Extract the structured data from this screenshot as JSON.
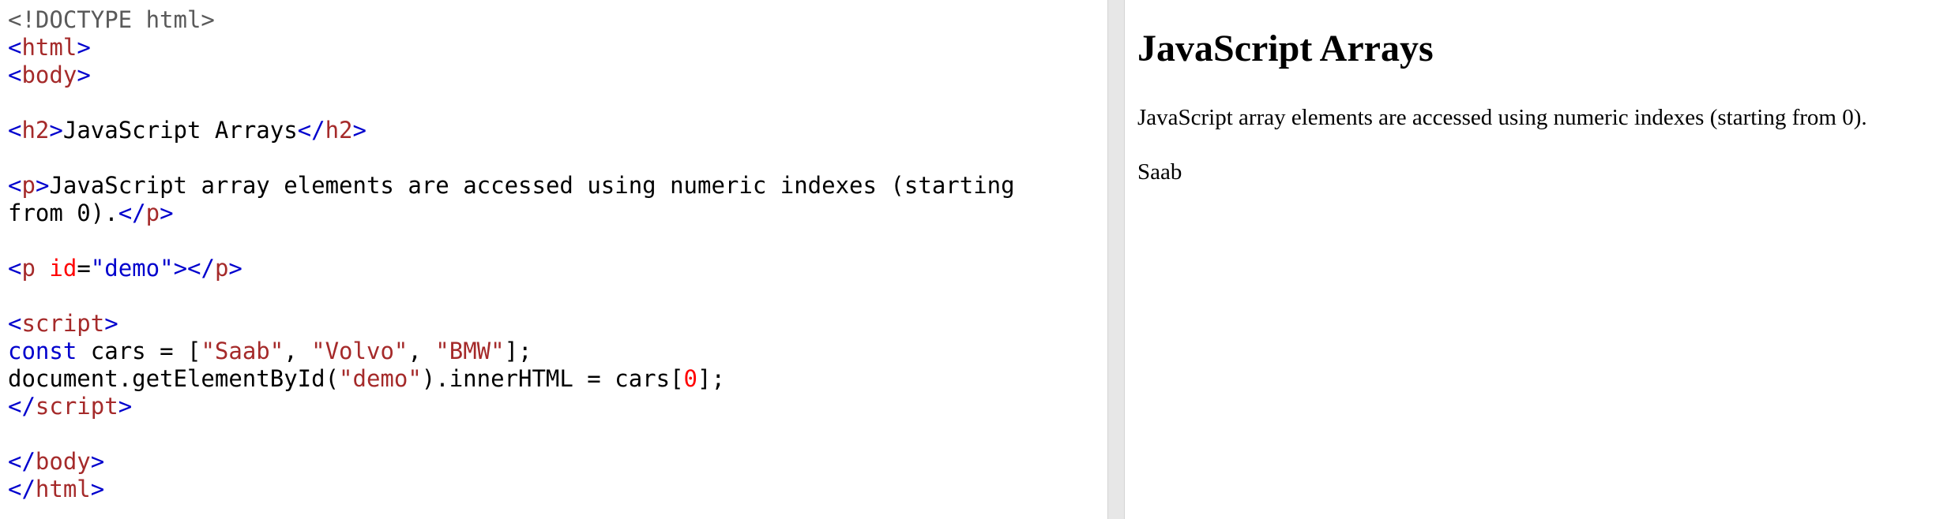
{
  "editor": {
    "lines": [
      [
        {
          "t": "doctype",
          "v": "<!DOCTYPE html>"
        }
      ],
      [
        {
          "t": "bracket",
          "v": "<"
        },
        {
          "t": "tag",
          "v": "html"
        },
        {
          "t": "bracket",
          "v": ">"
        }
      ],
      [
        {
          "t": "bracket",
          "v": "<"
        },
        {
          "t": "tag",
          "v": "body"
        },
        {
          "t": "bracket",
          "v": ">"
        }
      ],
      [],
      [
        {
          "t": "bracket",
          "v": "<"
        },
        {
          "t": "tag",
          "v": "h2"
        },
        {
          "t": "bracket",
          "v": ">"
        },
        {
          "t": "text",
          "v": "JavaScript Arrays"
        },
        {
          "t": "bracket",
          "v": "</"
        },
        {
          "t": "tag",
          "v": "h2"
        },
        {
          "t": "bracket",
          "v": ">"
        }
      ],
      [],
      [
        {
          "t": "bracket",
          "v": "<"
        },
        {
          "t": "tag",
          "v": "p"
        },
        {
          "t": "bracket",
          "v": ">"
        },
        {
          "t": "text",
          "v": "JavaScript array elements are accessed using numeric indexes (starting"
        }
      ],
      [
        {
          "t": "text",
          "v": "from 0)."
        },
        {
          "t": "bracket",
          "v": "</"
        },
        {
          "t": "tag",
          "v": "p"
        },
        {
          "t": "bracket",
          "v": ">"
        }
      ],
      [],
      [
        {
          "t": "bracket",
          "v": "<"
        },
        {
          "t": "tag",
          "v": "p"
        },
        {
          "t": "text",
          "v": " "
        },
        {
          "t": "attr",
          "v": "id"
        },
        {
          "t": "text",
          "v": "="
        },
        {
          "t": "attrval",
          "v": "\"demo\""
        },
        {
          "t": "bracket",
          "v": "></"
        },
        {
          "t": "tag",
          "v": "p"
        },
        {
          "t": "bracket",
          "v": ">"
        }
      ],
      [],
      [
        {
          "t": "bracket",
          "v": "<"
        },
        {
          "t": "tag",
          "v": "script"
        },
        {
          "t": "bracket",
          "v": ">"
        }
      ],
      [
        {
          "t": "keyword",
          "v": "const"
        },
        {
          "t": "text",
          "v": " cars = ["
        },
        {
          "t": "string",
          "v": "\"Saab\""
        },
        {
          "t": "text",
          "v": ", "
        },
        {
          "t": "string",
          "v": "\"Volvo\""
        },
        {
          "t": "text",
          "v": ", "
        },
        {
          "t": "string",
          "v": "\"BMW\""
        },
        {
          "t": "text",
          "v": "];"
        }
      ],
      [
        {
          "t": "text",
          "v": "document.getElementById("
        },
        {
          "t": "string",
          "v": "\"demo\""
        },
        {
          "t": "text",
          "v": ").innerHTML = cars["
        },
        {
          "t": "number",
          "v": "0"
        },
        {
          "t": "text",
          "v": "];"
        }
      ],
      [
        {
          "t": "bracket",
          "v": "</"
        },
        {
          "t": "tag",
          "v": "script"
        },
        {
          "t": "bracket",
          "v": ">"
        }
      ],
      [],
      [
        {
          "t": "bracket",
          "v": "</"
        },
        {
          "t": "tag",
          "v": "body"
        },
        {
          "t": "bracket",
          "v": ">"
        }
      ],
      [
        {
          "t": "bracket",
          "v": "</"
        },
        {
          "t": "tag",
          "v": "html"
        },
        {
          "t": "bracket",
          "v": ">"
        }
      ]
    ]
  },
  "preview": {
    "heading": "JavaScript Arrays",
    "paragraph": "JavaScript array elements are accessed using numeric indexes (starting from 0).",
    "demo": "Saab"
  },
  "colors": {
    "doctype": "#5a5a5a",
    "bracket": "#0000cd",
    "tag": "#a52a2a",
    "attr": "#ff0000",
    "attrval": "#0000cd",
    "keyword": "#0000cd",
    "string": "#a52a2a",
    "number": "#ff0000",
    "text": "#000000",
    "divider": "#e7e7e7"
  }
}
